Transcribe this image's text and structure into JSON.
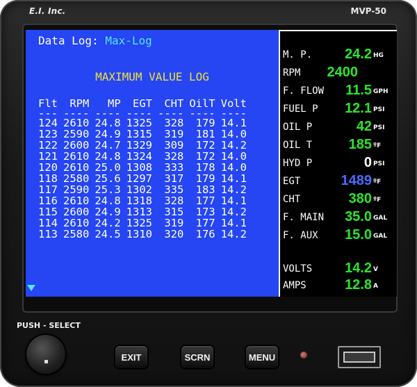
{
  "device": {
    "brand": "E.I. Inc.",
    "model": "MVP-50"
  },
  "log": {
    "title_prefix": "Data Log:",
    "mode": "Max-Log",
    "heading": "MAXIMUM VALUE LOG",
    "columns": [
      "Flt",
      "RPM",
      "MP",
      "EGT",
      "CHT",
      "OilT",
      "Volt"
    ],
    "dash": [
      "---",
      "----",
      "----",
      "----",
      "----",
      "----",
      "----"
    ],
    "rows": [
      [
        "124",
        "2610",
        "24.8",
        "1325",
        "328",
        "179",
        "14.1"
      ],
      [
        "123",
        "2590",
        "24.9",
        "1315",
        "319",
        "181",
        "14.0"
      ],
      [
        "122",
        "2600",
        "24.7",
        "1329",
        "309",
        "172",
        "14.2"
      ],
      [
        "121",
        "2610",
        "24.8",
        "1324",
        "328",
        "172",
        "14.0"
      ],
      [
        "120",
        "2610",
        "25.0",
        "1308",
        "333",
        "178",
        "14.0"
      ],
      [
        "118",
        "2580",
        "25.6",
        "1297",
        "317",
        "179",
        "14.1"
      ],
      [
        "117",
        "2590",
        "25.3",
        "1302",
        "335",
        "183",
        "14.2"
      ],
      [
        "116",
        "2610",
        "24.8",
        "1318",
        "328",
        "177",
        "14.1"
      ],
      [
        "115",
        "2600",
        "24.9",
        "1313",
        "315",
        "173",
        "14.2"
      ],
      [
        "114",
        "2610",
        "24.2",
        "1325",
        "319",
        "177",
        "14.1"
      ],
      [
        "113",
        "2580",
        "24.5",
        "1310",
        "320",
        "176",
        "14.2"
      ]
    ]
  },
  "gauges": [
    {
      "label": "M. P.",
      "value": "24.2",
      "unit": "HG",
      "color": "#2be62b"
    },
    {
      "label": "RPM",
      "value": "2400",
      "unit": "",
      "color": "#2be62b"
    },
    {
      "label": "F. FLOW",
      "value": "11.5",
      "unit": "GPH",
      "color": "#2be62b"
    },
    {
      "label": "FUEL P",
      "value": "12.1",
      "unit": "PSI",
      "color": "#2be62b"
    },
    {
      "label": "OIL P",
      "value": "42",
      "unit": "PSI",
      "color": "#2be62b"
    },
    {
      "label": "OIL T",
      "value": "185",
      "unit": "ºF",
      "color": "#2be62b"
    },
    {
      "label": "HYD P",
      "value": "0",
      "unit": "PSI",
      "color": "#ffffff"
    },
    {
      "label": "EGT",
      "value": "1489",
      "unit": "ºF",
      "color": "#4a6bff"
    },
    {
      "label": "CHT",
      "value": "380",
      "unit": "ºF",
      "color": "#2be62b"
    },
    {
      "label": "F. MAIN",
      "value": "35.0",
      "unit": "GAL",
      "color": "#2be62b"
    },
    {
      "label": "F. AUX",
      "value": "15.0",
      "unit": "GAL",
      "color": "#2be62b"
    },
    {
      "label": "VOLTS",
      "value": "14.2",
      "unit": "V",
      "color": "#2be62b"
    },
    {
      "label": "AMPS",
      "value": "12.8",
      "unit": "A",
      "color": "#2be62b"
    }
  ],
  "controls": {
    "push_select": "PUSH - SELECT",
    "exit": "EXIT",
    "scrn": "SCRN",
    "menu": "MENU"
  }
}
